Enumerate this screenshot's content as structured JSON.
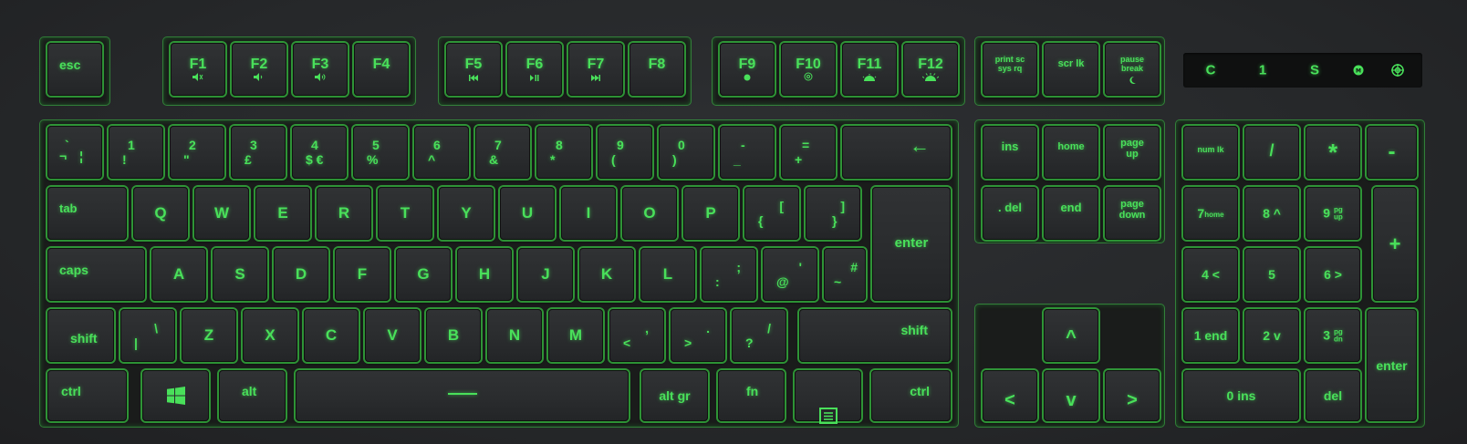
{
  "keyboard": {
    "glow_color": "#49e05a",
    "indicators": [
      "C",
      "1",
      "S"
    ],
    "keys": {
      "esc": "esc",
      "f1": "F1",
      "f2": "F2",
      "f3": "F3",
      "f4": "F4",
      "f5": "F5",
      "f6": "F6",
      "f7": "F7",
      "f8": "F8",
      "f9": "F9",
      "f10": "F10",
      "f11": "F11",
      "f12": "F12",
      "prtsc": "print sc\nsys rq",
      "scrlk": "scr lk",
      "pause": "pause\nbreak",
      "grave_top": "`",
      "grave_bottom": "¬",
      "grave_right": "¦",
      "n1": "1",
      "n1s": "!",
      "n2": "2",
      "n2s": "\"",
      "n3": "3",
      "n3s": "£",
      "n4": "4",
      "n4s": "$ €",
      "n5": "5",
      "n5s": "%",
      "n6": "6",
      "n6s": "^",
      "n7": "7",
      "n7s": "&",
      "n8": "8",
      "n8s": "*",
      "n9": "9",
      "n9s": "(",
      "n0": "0",
      "n0s": ")",
      "minus": "-",
      "minus_s": "_",
      "equal": "=",
      "equal_s": "+",
      "backspace": "←",
      "tab": "tab",
      "q": "Q",
      "w": "W",
      "e": "E",
      "r": "R",
      "t": "T",
      "y": "Y",
      "u": "U",
      "i": "I",
      "o": "O",
      "p": "P",
      "lbracket": "[",
      "lbrace": "{",
      "rbracket": "]",
      "rbrace": "}",
      "enter": "enter",
      "caps": "caps",
      "a": "A",
      "s": "S",
      "d": "D",
      "f": "F",
      "g": "G",
      "h": "H",
      "j": "J",
      "k": "K",
      "l": "L",
      "semicolon": ";",
      "colon": ":",
      "quote": "'",
      "at": "@",
      "hash": "#",
      "tilde": "~",
      "lshift": "shift",
      "backslash": "\\",
      "pipe": "|",
      "z": "Z",
      "x": "X",
      "c": "C",
      "v": "V",
      "b": "B",
      "n": "N",
      "m": "M",
      "comma": ",",
      "lt": "<",
      "period": ".",
      "gt": ">",
      "slash": "/",
      "question": "?",
      "rshift": "shift",
      "lctrl": "ctrl",
      "alt": "alt",
      "altgr": "alt gr",
      "fn": "fn",
      "rctrl": "ctrl",
      "ins": "ins",
      "home": "home",
      "pageup": "page\nup",
      "del": ". del",
      "end": "end",
      "pagedown": "page\ndown",
      "up": "^",
      "left": "<",
      "down": "v",
      "right": ">",
      "numlk": "num lk",
      "np_slash": "/",
      "np_star": "*",
      "np_minus": "-",
      "np7": "7",
      "np7s": "home",
      "np8": "8 ^",
      "np9": "9",
      "np9s": "pg\nup",
      "np_plus": "+",
      "np4": "4 <",
      "np5": "5",
      "np6": "6 >",
      "np1": "1 end",
      "np2": "2 v",
      "np3": "3",
      "np3s": "pg\ndn",
      "np_enter": "enter",
      "np0": "0 ins",
      "np_del": "del"
    }
  }
}
